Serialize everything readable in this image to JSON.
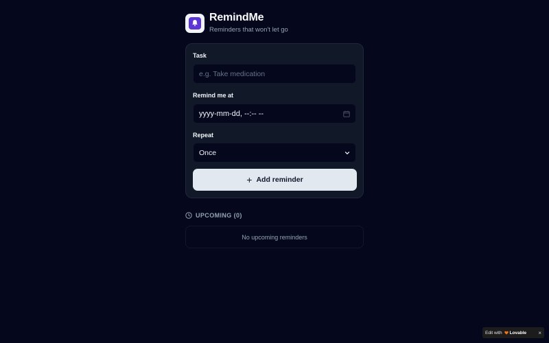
{
  "app": {
    "title": "RemindMe",
    "subtitle": "Reminders that won't let go",
    "logo_icon": "bell-icon"
  },
  "form": {
    "task_label": "Task",
    "task_placeholder": "e.g. Take medication",
    "task_value": "",
    "time_label": "Remind me at",
    "time_value": "yyyy-mm-dd, --:-- --",
    "repeat_label": "Repeat",
    "repeat_value": "Once",
    "add_button_label": "Add reminder"
  },
  "upcoming": {
    "heading": "UPCOMING (0)",
    "empty_text": "No upcoming reminders"
  },
  "badge": {
    "edit_with": "Edit with",
    "brand": "Lovable",
    "close": "×"
  },
  "colors": {
    "background": "#05071c",
    "card": "#111827",
    "accent": "#5b35d5",
    "button": "#e2e8f0"
  }
}
